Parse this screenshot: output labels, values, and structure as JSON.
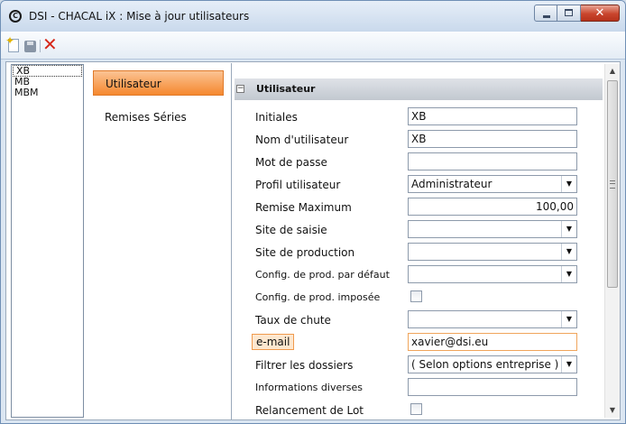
{
  "window": {
    "title": "DSI - CHACAL iX : Mise à jour utilisateurs",
    "app_icon_glyph": "C",
    "buttons": {
      "close_glyph": "✕"
    }
  },
  "toolbar": {
    "icons": [
      "new-icon",
      "save-icon",
      "delete-icon"
    ],
    "delete_glyph": "✕",
    "new_glyph": "✦"
  },
  "users": [
    "XB",
    "MB",
    "MBM"
  ],
  "nav": [
    {
      "label": "Utilisateur",
      "active": true
    },
    {
      "label": "Remises Séries",
      "active": false
    }
  ],
  "section": {
    "title": "Utilisateur",
    "collapse_glyph": "−"
  },
  "fields": [
    {
      "label": "Initiales",
      "value": "XB",
      "type": "text"
    },
    {
      "label": "Nom d'utilisateur",
      "value": "XB",
      "type": "text"
    },
    {
      "label": "Mot de passe",
      "value": "",
      "type": "text"
    },
    {
      "label": "Profil utilisateur",
      "value": "Administrateur",
      "type": "select"
    },
    {
      "label": "Remise Maximum",
      "value": "100,00",
      "type": "number"
    },
    {
      "label": "Site de saisie",
      "value": "",
      "type": "select"
    },
    {
      "label": "Site de production",
      "value": "",
      "type": "select"
    },
    {
      "label": "Config. de prod. par défaut",
      "value": "",
      "type": "select"
    },
    {
      "label": "Config. de prod. imposée",
      "value": false,
      "type": "checkbox"
    },
    {
      "label": "Taux de chute",
      "value": "",
      "type": "select"
    },
    {
      "label": "e-mail",
      "value": "xavier@dsi.eu",
      "type": "text",
      "focused": true
    },
    {
      "label": "Filtrer les dossiers",
      "value": "( Selon options entreprise )",
      "type": "select"
    },
    {
      "label": "Informations diverses",
      "value": "",
      "type": "text"
    },
    {
      "label": "Relancement  de Lot",
      "value": false,
      "type": "checkbox"
    }
  ],
  "dropdown_glyph": "▼",
  "scrollbar": {
    "up_glyph": "▲",
    "down_glyph": "▼"
  },
  "colors": {
    "accent": "#f5882f",
    "titlebar": "#c9d9ec",
    "close": "#c9452d"
  }
}
